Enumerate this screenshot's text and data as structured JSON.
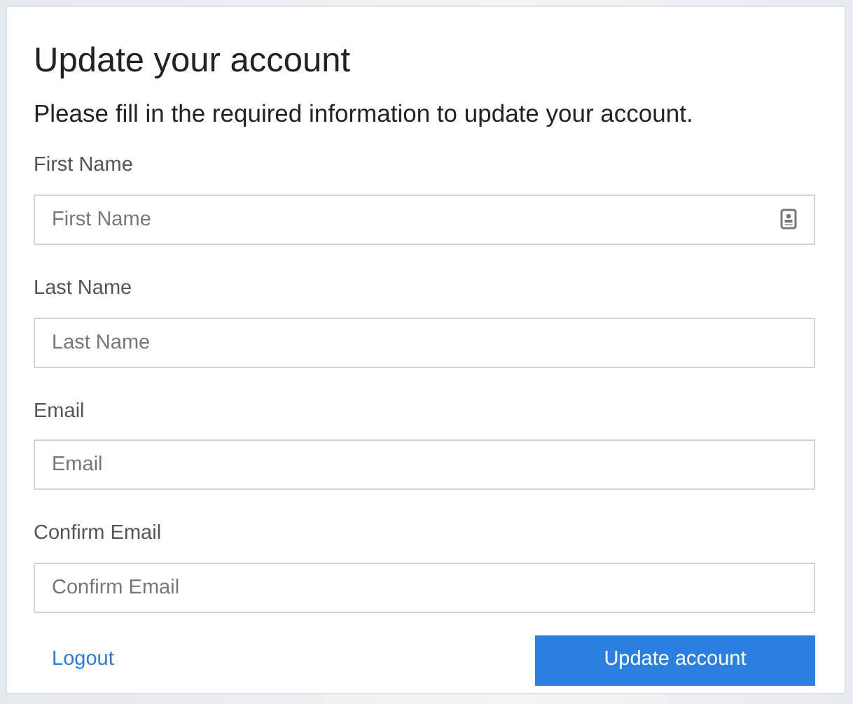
{
  "title": "Update your account",
  "subtitle": "Please fill in the required information to update your account.",
  "fields": [
    {
      "label": "First Name",
      "placeholder": "First Name",
      "kind": "autofill"
    },
    {
      "label": "Last Name",
      "placeholder": "Last Name",
      "kind": "text"
    },
    {
      "label": "Email",
      "placeholder": "Email",
      "kind": "text"
    },
    {
      "label": "Confirm Email",
      "placeholder": "Confirm Email",
      "kind": "text"
    }
  ],
  "logout_link": "Logout",
  "submit_button": "Update account"
}
